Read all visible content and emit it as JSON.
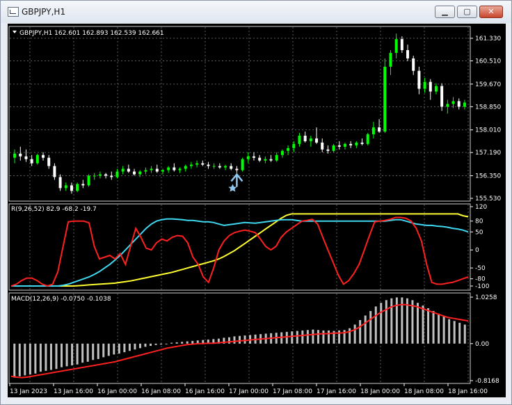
{
  "window": {
    "title": "GBPJPY,H1",
    "buttons": {
      "minimize": "▁",
      "maximize": "▢",
      "close": "✕"
    }
  },
  "colors": {
    "background": "#000000",
    "bull_candle": "#00ff00",
    "bear_candle": "#ffffff",
    "rvi_red": "#ff2020",
    "rvi_cyan": "#3fd8f0",
    "rvi_yellow": "#ffff30",
    "macd_hist": "#c0c0c0",
    "macd_signal": "#ff2020",
    "arrow": "#8ec8f0"
  },
  "main_pane": {
    "header": "GBPJPY,H1  162.601 162.893 162.539 162.661",
    "price_labels": [
      "161.330",
      "160.510",
      "159.670",
      "158.850",
      "158.010",
      "157.190",
      "156.350",
      "155.530"
    ],
    "arrow_icon": "up-arrow-icon",
    "star_icon": "star-icon"
  },
  "indicator_pane": {
    "header": "R(9,26,52) 82.9 -68.2 -19.7",
    "scale_labels": [
      "120",
      "80",
      "50",
      "0",
      "-50",
      "-80",
      "-100"
    ]
  },
  "macd_pane": {
    "header": "MACD(12,26,9) -0.0750 -0.1038",
    "scale_labels": [
      "1.0258",
      "0.00",
      "-0.8168"
    ]
  },
  "time_axis": {
    "labels": [
      "13 Jan 2023",
      "13 Jan 16:00",
      "16 Jan 00:00",
      "16 Jan 08:00",
      "16 Jan 16:00",
      "17 Jan 00:00",
      "17 Jan 08:00",
      "17 Jan 16:00",
      "18 Jan 00:00",
      "18 Jan 08:00",
      "18 Jan 16:00"
    ]
  },
  "chart_data": {
    "type": "candlestick",
    "ylim": [
      155.53,
      161.33
    ],
    "candles": [
      {
        "o": 157.0,
        "h": 157.3,
        "l": 156.8,
        "c": 157.15
      },
      {
        "o": 157.15,
        "h": 157.4,
        "l": 156.9,
        "c": 157.05
      },
      {
        "o": 157.05,
        "h": 157.3,
        "l": 156.85,
        "c": 156.95
      },
      {
        "o": 156.95,
        "h": 157.1,
        "l": 156.7,
        "c": 156.8
      },
      {
        "o": 156.8,
        "h": 157.15,
        "l": 156.75,
        "c": 157.1
      },
      {
        "o": 157.1,
        "h": 157.2,
        "l": 156.9,
        "c": 157.0
      },
      {
        "o": 157.0,
        "h": 157.1,
        "l": 156.6,
        "c": 156.7
      },
      {
        "o": 156.7,
        "h": 156.8,
        "l": 156.2,
        "c": 156.3
      },
      {
        "o": 156.3,
        "h": 156.4,
        "l": 155.8,
        "c": 155.9
      },
      {
        "o": 155.9,
        "h": 156.1,
        "l": 155.8,
        "c": 156.0
      },
      {
        "o": 156.0,
        "h": 156.1,
        "l": 155.7,
        "c": 155.8
      },
      {
        "o": 155.8,
        "h": 156.1,
        "l": 155.75,
        "c": 156.05
      },
      {
        "o": 156.05,
        "h": 156.2,
        "l": 155.9,
        "c": 156.0
      },
      {
        "o": 156.0,
        "h": 156.4,
        "l": 155.95,
        "c": 156.35
      },
      {
        "o": 156.35,
        "h": 156.45,
        "l": 156.2,
        "c": 156.35
      },
      {
        "o": 156.35,
        "h": 156.5,
        "l": 156.25,
        "c": 156.4
      },
      {
        "o": 156.4,
        "h": 156.45,
        "l": 156.25,
        "c": 156.35
      },
      {
        "o": 156.35,
        "h": 156.5,
        "l": 156.2,
        "c": 156.3
      },
      {
        "o": 156.3,
        "h": 156.6,
        "l": 156.25,
        "c": 156.5
      },
      {
        "o": 156.5,
        "h": 156.7,
        "l": 156.4,
        "c": 156.6
      },
      {
        "o": 156.6,
        "h": 156.75,
        "l": 156.45,
        "c": 156.5
      },
      {
        "o": 156.5,
        "h": 156.6,
        "l": 156.35,
        "c": 156.4
      },
      {
        "o": 156.4,
        "h": 156.55,
        "l": 156.3,
        "c": 156.5
      },
      {
        "o": 156.5,
        "h": 156.65,
        "l": 156.4,
        "c": 156.55
      },
      {
        "o": 156.55,
        "h": 156.7,
        "l": 156.45,
        "c": 156.6
      },
      {
        "o": 156.6,
        "h": 156.75,
        "l": 156.45,
        "c": 156.5
      },
      {
        "o": 156.5,
        "h": 156.6,
        "l": 156.4,
        "c": 156.55
      },
      {
        "o": 156.55,
        "h": 156.7,
        "l": 156.45,
        "c": 156.65
      },
      {
        "o": 156.65,
        "h": 156.8,
        "l": 156.5,
        "c": 156.55
      },
      {
        "o": 156.55,
        "h": 156.65,
        "l": 156.45,
        "c": 156.6
      },
      {
        "o": 156.6,
        "h": 156.75,
        "l": 156.5,
        "c": 156.7
      },
      {
        "o": 156.7,
        "h": 156.85,
        "l": 156.6,
        "c": 156.75
      },
      {
        "o": 156.75,
        "h": 156.9,
        "l": 156.65,
        "c": 156.8
      },
      {
        "o": 156.8,
        "h": 156.9,
        "l": 156.7,
        "c": 156.75
      },
      {
        "o": 156.75,
        "h": 156.85,
        "l": 156.6,
        "c": 156.7
      },
      {
        "o": 156.7,
        "h": 156.8,
        "l": 156.6,
        "c": 156.7
      },
      {
        "o": 156.7,
        "h": 156.8,
        "l": 156.6,
        "c": 156.65
      },
      {
        "o": 156.65,
        "h": 156.75,
        "l": 156.55,
        "c": 156.7
      },
      {
        "o": 156.7,
        "h": 156.8,
        "l": 156.55,
        "c": 156.6
      },
      {
        "o": 156.6,
        "h": 156.7,
        "l": 156.45,
        "c": 156.55
      },
      {
        "o": 156.55,
        "h": 157.0,
        "l": 156.5,
        "c": 156.95
      },
      {
        "o": 156.95,
        "h": 157.2,
        "l": 156.8,
        "c": 157.05
      },
      {
        "o": 157.05,
        "h": 157.2,
        "l": 156.9,
        "c": 157.0
      },
      {
        "o": 157.0,
        "h": 157.1,
        "l": 156.85,
        "c": 156.9
      },
      {
        "o": 156.9,
        "h": 157.05,
        "l": 156.8,
        "c": 156.95
      },
      {
        "o": 156.95,
        "h": 157.1,
        "l": 156.85,
        "c": 156.9
      },
      {
        "o": 156.9,
        "h": 157.2,
        "l": 156.85,
        "c": 157.1
      },
      {
        "o": 157.1,
        "h": 157.3,
        "l": 157.0,
        "c": 157.25
      },
      {
        "o": 157.25,
        "h": 157.45,
        "l": 157.1,
        "c": 157.35
      },
      {
        "o": 157.35,
        "h": 157.6,
        "l": 157.2,
        "c": 157.5
      },
      {
        "o": 157.5,
        "h": 157.9,
        "l": 157.4,
        "c": 157.8
      },
      {
        "o": 157.8,
        "h": 157.95,
        "l": 157.55,
        "c": 157.6
      },
      {
        "o": 157.6,
        "h": 157.8,
        "l": 157.4,
        "c": 157.7
      },
      {
        "o": 157.7,
        "h": 158.1,
        "l": 157.5,
        "c": 157.55
      },
      {
        "o": 157.55,
        "h": 157.7,
        "l": 157.2,
        "c": 157.3
      },
      {
        "o": 157.3,
        "h": 157.45,
        "l": 157.15,
        "c": 157.25
      },
      {
        "o": 157.25,
        "h": 157.5,
        "l": 157.2,
        "c": 157.45
      },
      {
        "o": 157.45,
        "h": 157.6,
        "l": 157.3,
        "c": 157.4
      },
      {
        "o": 157.4,
        "h": 157.55,
        "l": 157.3,
        "c": 157.5
      },
      {
        "o": 157.5,
        "h": 157.6,
        "l": 157.35,
        "c": 157.45
      },
      {
        "o": 157.45,
        "h": 157.6,
        "l": 157.35,
        "c": 157.55
      },
      {
        "o": 157.55,
        "h": 157.7,
        "l": 157.45,
        "c": 157.5
      },
      {
        "o": 157.5,
        "h": 157.9,
        "l": 157.45,
        "c": 157.85
      },
      {
        "o": 157.85,
        "h": 158.3,
        "l": 157.7,
        "c": 158.1
      },
      {
        "o": 158.1,
        "h": 158.4,
        "l": 157.9,
        "c": 157.95
      },
      {
        "o": 157.95,
        "h": 160.6,
        "l": 157.9,
        "c": 160.3
      },
      {
        "o": 160.3,
        "h": 160.9,
        "l": 160.0,
        "c": 160.8
      },
      {
        "o": 160.8,
        "h": 161.5,
        "l": 160.6,
        "c": 161.3
      },
      {
        "o": 161.3,
        "h": 161.4,
        "l": 160.8,
        "c": 160.9
      },
      {
        "o": 160.9,
        "h": 161.1,
        "l": 160.5,
        "c": 160.6
      },
      {
        "o": 160.6,
        "h": 160.7,
        "l": 160.0,
        "c": 160.15
      },
      {
        "o": 160.15,
        "h": 160.3,
        "l": 159.3,
        "c": 159.5
      },
      {
        "o": 159.5,
        "h": 159.9,
        "l": 159.35,
        "c": 159.75
      },
      {
        "o": 159.75,
        "h": 159.85,
        "l": 159.1,
        "c": 159.4
      },
      {
        "o": 159.4,
        "h": 159.7,
        "l": 159.3,
        "c": 159.6
      },
      {
        "o": 159.6,
        "h": 159.7,
        "l": 158.7,
        "c": 158.85
      },
      {
        "o": 158.85,
        "h": 159.1,
        "l": 158.6,
        "c": 158.95
      },
      {
        "o": 158.95,
        "h": 159.2,
        "l": 158.8,
        "c": 159.05
      },
      {
        "o": 159.05,
        "h": 159.15,
        "l": 158.75,
        "c": 158.85
      },
      {
        "o": 158.85,
        "h": 159.1,
        "l": 158.75,
        "c": 159.0
      }
    ],
    "rvi": {
      "ylim": [
        -100,
        120
      ],
      "red": [
        -100,
        -95,
        -85,
        -78,
        -78,
        -85,
        -95,
        -100,
        -95,
        -60,
        10,
        78,
        80,
        80,
        80,
        75,
        10,
        -25,
        -20,
        -15,
        -25,
        -10,
        -40,
        10,
        60,
        35,
        5,
        0,
        20,
        30,
        25,
        35,
        40,
        38,
        20,
        -20,
        -40,
        -75,
        -90,
        -50,
        0,
        25,
        40,
        48,
        52,
        55,
        52,
        48,
        30,
        10,
        0,
        10,
        35,
        50,
        60,
        70,
        80,
        82,
        85,
        72,
        35,
        0,
        -35,
        -70,
        -95,
        -85,
        -65,
        -40,
        0,
        40,
        78,
        80,
        82,
        85,
        90,
        90,
        88,
        80,
        60,
        25,
        -40,
        -90,
        -95,
        -95,
        -92,
        -90,
        -85,
        -80,
        -75
      ],
      "cyan": [
        -100,
        -100,
        -100,
        -100,
        -100,
        -100,
        -100,
        -100,
        -100,
        -100,
        -98,
        -95,
        -90,
        -85,
        -80,
        -75,
        -68,
        -60,
        -50,
        -40,
        -28,
        -15,
        0,
        15,
        30,
        45,
        60,
        72,
        80,
        84,
        86,
        86,
        85,
        84,
        82,
        82,
        80,
        78,
        78,
        76,
        72,
        68,
        70,
        72,
        74,
        76,
        75,
        74,
        76,
        78,
        80,
        82,
        84,
        84,
        84,
        82,
        80,
        80,
        80,
        80,
        80,
        80,
        80,
        80,
        80,
        80,
        80,
        80,
        80,
        80,
        80,
        80,
        80,
        82,
        84,
        84,
        80,
        76,
        72,
        70,
        68,
        68,
        66,
        65,
        63,
        60,
        58,
        55,
        50
      ],
      "yellow": [
        -100,
        -100,
        -100,
        -100,
        -100,
        -100,
        -100,
        -100,
        -100,
        -100,
        -100,
        -100,
        -100,
        -99,
        -98,
        -97,
        -96,
        -95,
        -94,
        -93,
        -92,
        -90,
        -88,
        -86,
        -83,
        -80,
        -77,
        -74,
        -71,
        -68,
        -65,
        -62,
        -58,
        -54,
        -50,
        -46,
        -42,
        -38,
        -34,
        -30,
        -25,
        -18,
        -10,
        -2,
        8,
        18,
        28,
        38,
        48,
        58,
        68,
        78,
        88,
        96,
        100,
        100,
        100,
        100,
        100,
        100,
        100,
        100,
        100,
        100,
        100,
        100,
        100,
        100,
        100,
        100,
        100,
        100,
        100,
        100,
        100,
        100,
        100,
        100,
        100,
        100,
        100,
        100,
        100,
        100,
        100,
        100,
        100,
        95,
        92
      ]
    },
    "macd": {
      "ylim": [
        -0.8168,
        1.0258
      ],
      "hist": [
        -0.75,
        -0.72,
        -0.7,
        -0.68,
        -0.66,
        -0.62,
        -0.6,
        -0.58,
        -0.56,
        -0.52,
        -0.5,
        -0.48,
        -0.46,
        -0.42,
        -0.4,
        -0.36,
        -0.34,
        -0.3,
        -0.27,
        -0.24,
        -0.22,
        -0.19,
        -0.16,
        -0.13,
        -0.1,
        -0.07,
        -0.05,
        -0.03,
        -0.02,
        0.0,
        0.02,
        0.03,
        0.04,
        0.05,
        0.06,
        0.07,
        0.08,
        0.09,
        0.1,
        0.11,
        0.13,
        0.14,
        0.16,
        0.17,
        0.18,
        0.19,
        0.2,
        0.21,
        0.22,
        0.23,
        0.24,
        0.25,
        0.26,
        0.27,
        0.28,
        0.29,
        0.3,
        0.31,
        0.3,
        0.29,
        0.29,
        0.28,
        0.29,
        0.3,
        0.34,
        0.42,
        0.52,
        0.62,
        0.72,
        0.82,
        0.9,
        0.96,
        1.0,
        1.02,
        1.02,
        1.0,
        0.96,
        0.9,
        0.84,
        0.78,
        0.72,
        0.66,
        0.6,
        0.54,
        0.5,
        0.46,
        0.42
      ],
      "signal": [
        -0.72,
        -0.74,
        -0.75,
        -0.74,
        -0.72,
        -0.7,
        -0.68,
        -0.66,
        -0.64,
        -0.62,
        -0.6,
        -0.58,
        -0.56,
        -0.54,
        -0.52,
        -0.5,
        -0.48,
        -0.46,
        -0.44,
        -0.42,
        -0.4,
        -0.37,
        -0.34,
        -0.31,
        -0.28,
        -0.25,
        -0.22,
        -0.19,
        -0.16,
        -0.13,
        -0.1,
        -0.08,
        -0.06,
        -0.04,
        -0.02,
        -0.01,
        0.0,
        0.0,
        0.01,
        0.01,
        0.02,
        0.03,
        0.04,
        0.05,
        0.06,
        0.07,
        0.08,
        0.09,
        0.1,
        0.11,
        0.12,
        0.13,
        0.14,
        0.15,
        0.16,
        0.17,
        0.18,
        0.19,
        0.2,
        0.21,
        0.22,
        0.22,
        0.23,
        0.23,
        0.24,
        0.26,
        0.3,
        0.36,
        0.44,
        0.52,
        0.6,
        0.68,
        0.74,
        0.8,
        0.84,
        0.86,
        0.86,
        0.84,
        0.82,
        0.78,
        0.74,
        0.7,
        0.66,
        0.62,
        0.58,
        0.56,
        0.54,
        0.52,
        0.5
      ]
    }
  }
}
